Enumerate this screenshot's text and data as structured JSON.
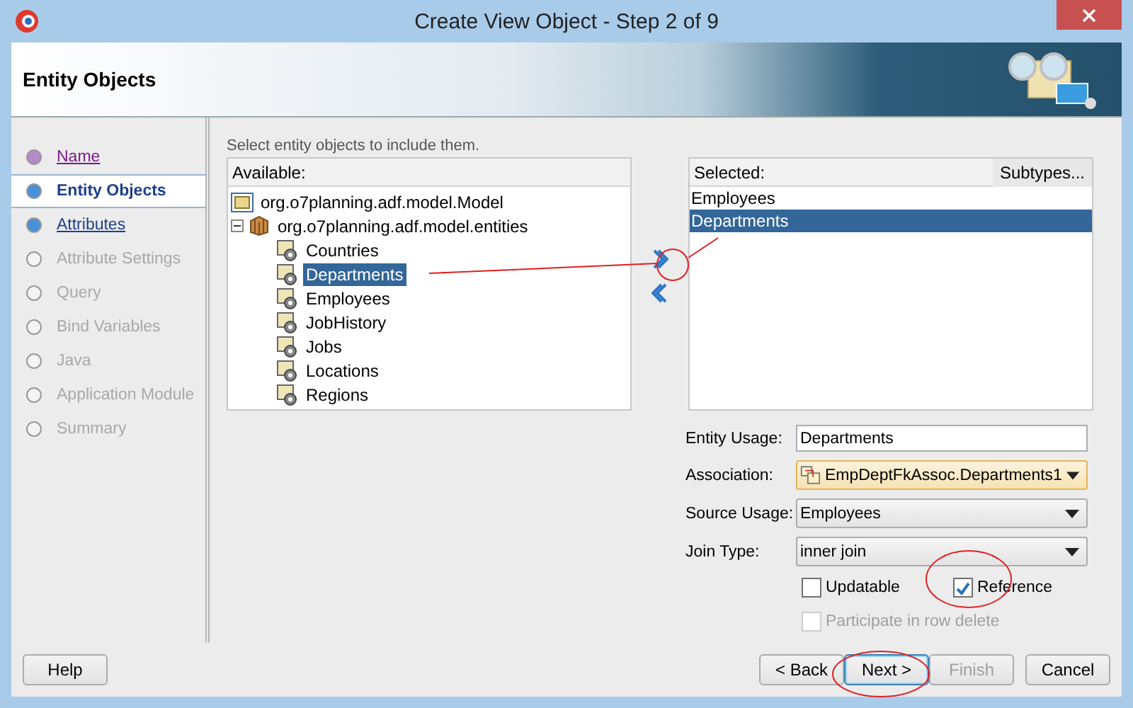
{
  "window": {
    "title": "Create View Object - Step 2 of 9"
  },
  "header": {
    "title": "Entity Objects"
  },
  "steps": [
    {
      "label": "Name",
      "selected": false,
      "visited": true,
      "disabled": false
    },
    {
      "label": "Entity Objects",
      "selected": true,
      "visited": false,
      "disabled": false
    },
    {
      "label": "Attributes",
      "selected": false,
      "visited": false,
      "disabled": false
    },
    {
      "label": "Attribute Settings",
      "selected": false,
      "visited": false,
      "disabled": true
    },
    {
      "label": "Query",
      "selected": false,
      "visited": false,
      "disabled": true
    },
    {
      "label": "Bind Variables",
      "selected": false,
      "visited": false,
      "disabled": true
    },
    {
      "label": "Java",
      "selected": false,
      "visited": false,
      "disabled": true
    },
    {
      "label": "Application Module",
      "selected": false,
      "visited": false,
      "disabled": true
    },
    {
      "label": "Summary",
      "selected": false,
      "visited": false,
      "disabled": true
    }
  ],
  "instruction": "Select entity objects to include them.",
  "available": {
    "header": "Available:",
    "tree": [
      {
        "label": "org.o7planning.adf.model.Model",
        "kind": "folder",
        "selected": false
      },
      {
        "label": "org.o7planning.adf.model.entities",
        "kind": "package",
        "selected": false,
        "expanded": true,
        "children": [
          {
            "label": "Countries",
            "kind": "entity",
            "selected": false
          },
          {
            "label": "Departments",
            "kind": "entity",
            "selected": true
          },
          {
            "label": "Employees",
            "kind": "entity",
            "selected": false
          },
          {
            "label": "JobHistory",
            "kind": "entity",
            "selected": false
          },
          {
            "label": "Jobs",
            "kind": "entity",
            "selected": false
          },
          {
            "label": "Locations",
            "kind": "entity",
            "selected": false
          },
          {
            "label": "Regions",
            "kind": "entity",
            "selected": false
          }
        ]
      }
    ]
  },
  "selected_list": {
    "header": "Selected:",
    "subtypes_button": "Subtypes...",
    "items": [
      {
        "label": "Employees",
        "selected": false
      },
      {
        "label": "Departments",
        "selected": true
      }
    ]
  },
  "form": [
    {
      "label": "Entity Usage:",
      "kind": "text",
      "value": "Departments"
    },
    {
      "label": "Association:",
      "kind": "association",
      "value": "EmpDeptFkAssoc.Departments1"
    },
    {
      "label": "Source Usage:",
      "kind": "dropdown",
      "value": "Employees"
    },
    {
      "label": "Join Type:",
      "kind": "dropdown",
      "value": "inner join"
    }
  ],
  "checkboxes": [
    {
      "label": "Updatable",
      "checked": false,
      "disabled": false
    },
    {
      "label": "Reference",
      "checked": true,
      "disabled": false
    }
  ],
  "participate": {
    "label": "Participate in row delete",
    "checked": false,
    "disabled": true
  },
  "buttons": {
    "help": "Help",
    "nav": [
      {
        "label": "< Back",
        "disabled": false,
        "default": false
      },
      {
        "label": "Next >",
        "disabled": false,
        "default": true
      },
      {
        "label": "Finish",
        "disabled": true,
        "default": false
      },
      {
        "label": "Cancel",
        "disabled": false,
        "default": false
      }
    ]
  }
}
